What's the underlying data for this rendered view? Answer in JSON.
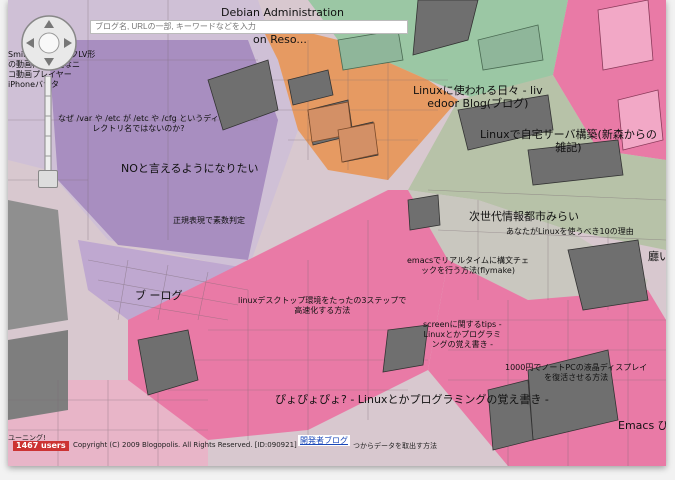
{
  "search": {
    "placeholder": "ブログ名, URLの一部, キーワードなどを入力"
  },
  "users": "1467 users",
  "copyright": "Copyright (C) 2009 Blogopolis. All Rights Reserved. [ID:090921]",
  "developer_link": "開発者ブログ",
  "footer_tail": "つからデータを取出す方法",
  "footer_head": "ユーニング!",
  "labels": {
    "debian": "Debian Administration",
    "debian2": "on Reso...",
    "smile": "SmileブックマークLV形\nの動画再生可能なニ\nコ動画プレイヤー\niPhoneバナタ",
    "var_etc": "なぜ /var や /etc が /etc や /cfg というディ\nレクトリ名ではないのか?",
    "no": "NOと言えるようになりたい",
    "regex": "正規表現で素数判定",
    "blog": "ブ ーログ",
    "linux_days": "Linuxに使われる日々 - liv\nedoor Blog(ブログ)",
    "linux_server": "Linuxで自宅サーバ構築(新森からの\n雑記)",
    "next_city": "次世代情報都市みらい",
    "linux10": "あなたがLinuxを使うべき10の理由",
    "emacs_rt": "emacsでリアルタイムに構文チェ\nックを行う方法(flymake)",
    "desktop": "linuxデスクトップ環境をたったの3ステップで\n高速化する方法",
    "screen": "screenに関するtips -\nLinuxとかプログラミ\nングの覚え書き -",
    "lcd": "1000円でノートPCの液晶ディスプレイ\nを復活させる方法",
    "pyopyo": "ぴょぴょぴょ? - Linuxとかプログラミングの覚え書き -",
    "emacs_right": "Emacs ぴ",
    "right_edge": "廳い"
  },
  "colors": {
    "pink": "#e97aa6",
    "purple": "#a88ec0",
    "green": "#9bc7a4",
    "orange": "#e69a62",
    "gray": "#9a9a9a"
  },
  "icons": {
    "pan": "pan-control-icon",
    "zoom": "zoom-slider-icon"
  }
}
